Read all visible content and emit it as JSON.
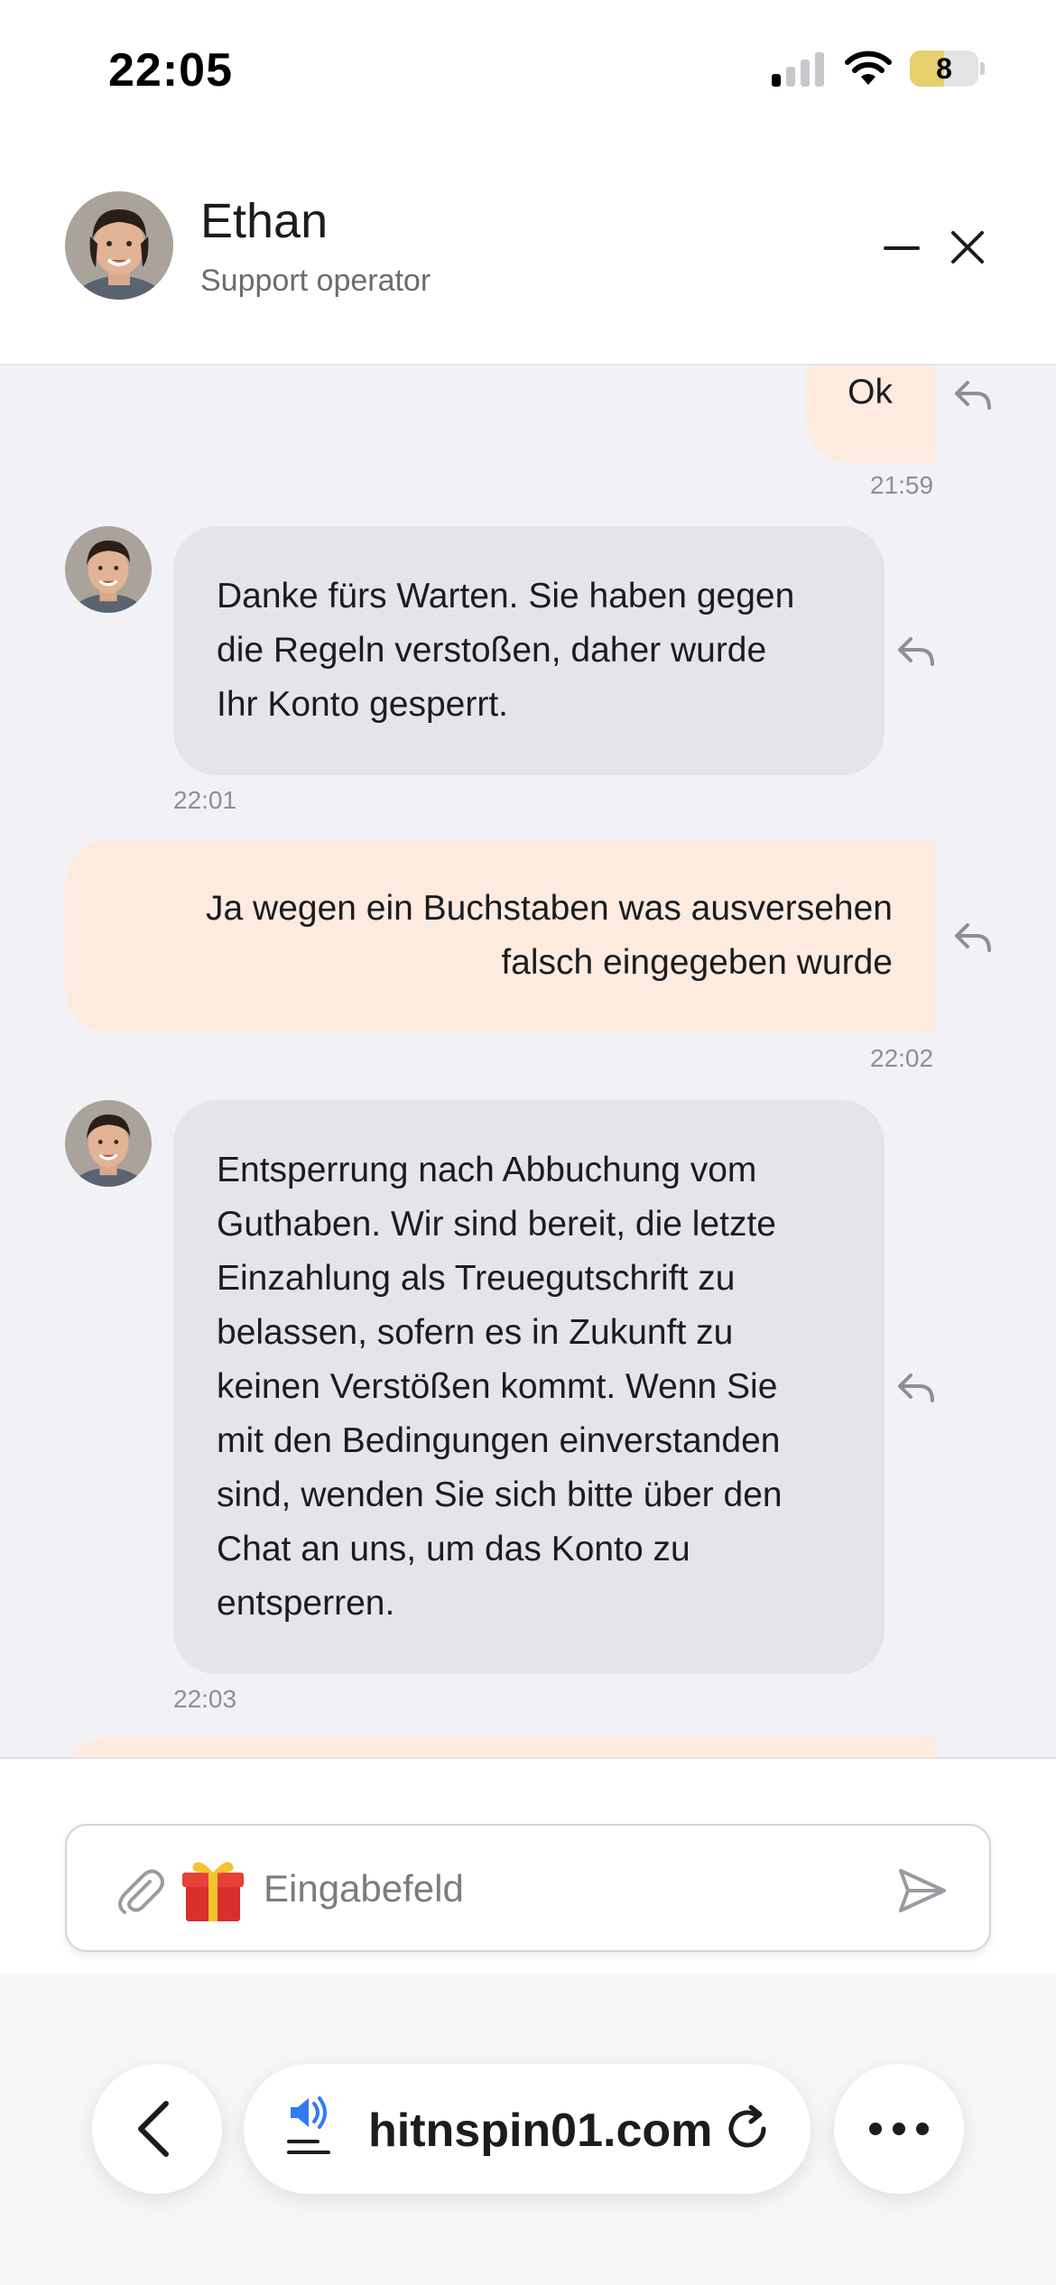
{
  "status_bar": {
    "time": "22:05",
    "battery_level": "8",
    "battery_fraction": 0.5,
    "signal_bars_active": 1,
    "signal_bars_total": 4
  },
  "header": {
    "agent_name": "Ethan",
    "agent_role": "Support operator",
    "minimize_icon": "minimize-icon",
    "close_icon": "close-icon"
  },
  "colors": {
    "incoming_bubble": "#e4e4e9",
    "outgoing_bubble": "#fdebe0",
    "chat_background": "#f2f2f6",
    "accent_blue": "#3478f6"
  },
  "messages": [
    {
      "direction": "outgoing",
      "text": "Ok",
      "time": "21:59"
    },
    {
      "direction": "incoming",
      "text": "Danke fürs Warten. Sie haben gegen die Regeln verstoßen, daher wurde Ihr Konto gesperrt.",
      "lines": [
        "Danke fürs Warten. Sie haben gegen",
        "die Regeln verstoßen, daher wurde",
        "Ihr Konto gesperrt."
      ],
      "time": "22:01"
    },
    {
      "direction": "outgoing",
      "text": "Ja wegen ein Buchstaben was ausversehen falsch eingegeben wurde",
      "lines": [
        "Ja wegen ein Buchstaben was ausversehen",
        "falsch eingegeben wurde"
      ],
      "time": "22:02"
    },
    {
      "direction": "incoming",
      "text": "Entsperrung nach Abbuchung vom Guthaben. Wir sind bereit, die letzte Einzahlung als Treuegutschrift zu belassen, sofern es in Zukunft zu keinen Verstößen kommt. Wenn Sie mit den Bedingungen einverstanden sind, wenden Sie sich bitte über den Chat an uns, um das Konto zu entsperren.",
      "lines": [
        "Entsperrung nach Abbuchung vom",
        "Guthaben. Wir sind bereit, die letzte",
        "Einzahlung als Treuegutschrift zu",
        "belassen, sofern es in Zukunft zu",
        "keinen Verstößen kommt. Wenn Sie",
        "mit den Bedingungen einverstanden",
        "sind, wenden Sie sich bitte über den",
        "Chat an uns, um das Konto zu",
        "entsperren."
      ],
      "time": "22:03"
    }
  ],
  "composer": {
    "placeholder": "Eingabefeld",
    "attach_icon": "paperclip-icon",
    "gift_icon": "gift-icon",
    "send_icon": "send-icon"
  },
  "browser": {
    "url": "hitnspin01.com",
    "back_icon": "chevron-left-icon",
    "speaker_icon": "speaker-icon",
    "reload_icon": "reload-icon",
    "more_icon": "more-icon"
  }
}
